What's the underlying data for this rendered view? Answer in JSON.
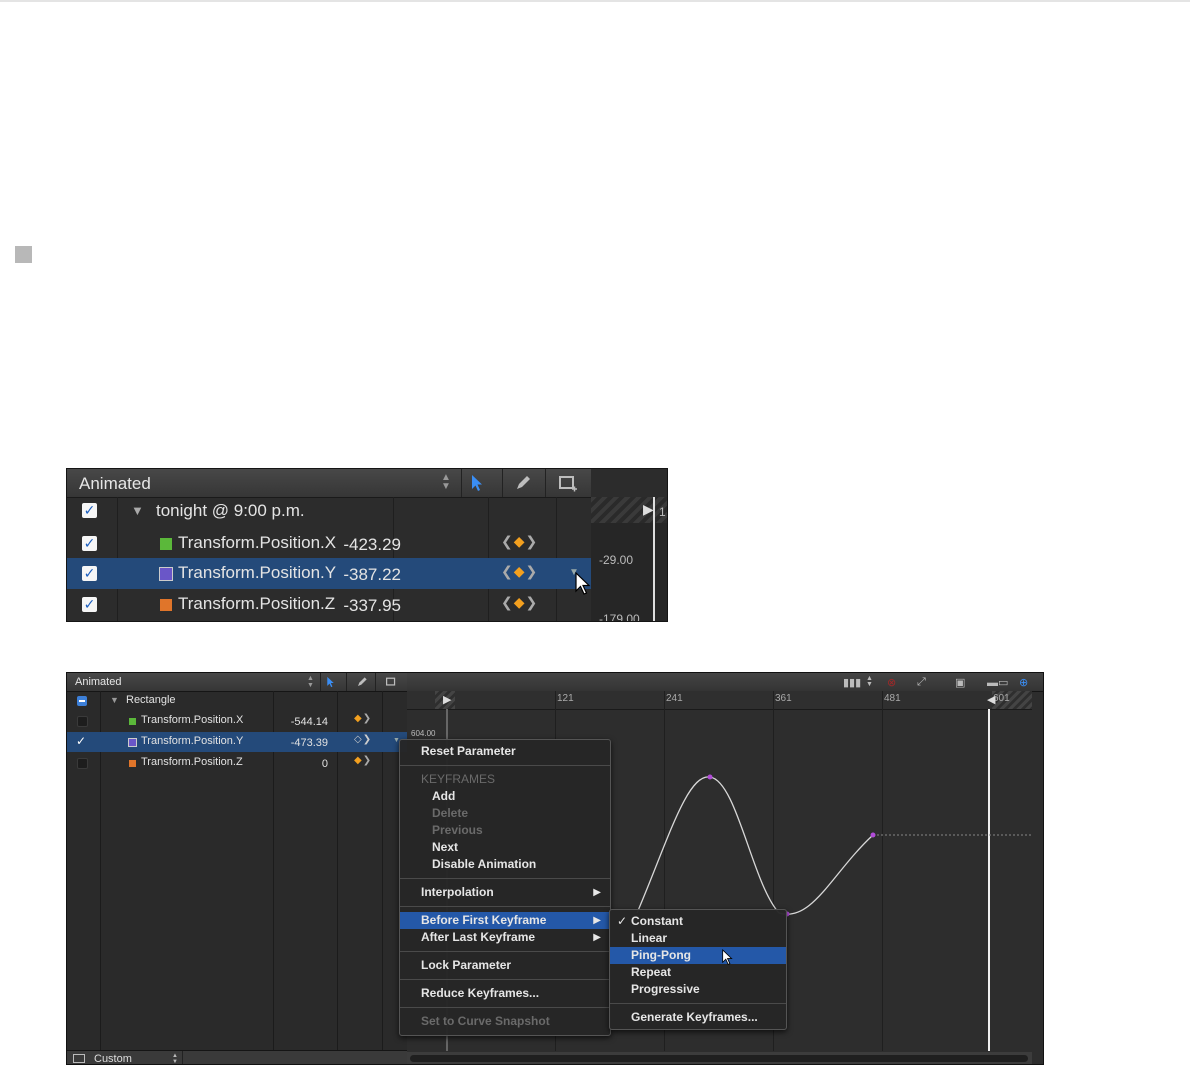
{
  "colors": {
    "selection": "#244a7a",
    "menu_highlight": "#2458a8",
    "keyframe": "#f3a01f",
    "swatch_x": "#5bb83a",
    "swatch_y": "#6a56c8",
    "swatch_z": "#e0752a",
    "curve": "#d8d8d8",
    "curve_point": "#b14cd8"
  },
  "panel_zoom": {
    "title": "Animated",
    "group": "tonight @ 9:00 p.m.",
    "rows": [
      {
        "name": "Transform.Position.X",
        "value": "-423.29",
        "swatch": "swatch_x"
      },
      {
        "name": "Transform.Position.Y",
        "value": "-387.22",
        "swatch": "swatch_y",
        "selected": true
      },
      {
        "name": "Transform.Position.Z",
        "value": "-337.95",
        "swatch": "swatch_z"
      }
    ],
    "ruler_value": "1",
    "graph_labels": [
      "-29.00",
      "-179.00"
    ],
    "icons": [
      "updown-icon",
      "arrow-tool-icon",
      "pen-tool-icon",
      "frame-tool-icon",
      "checkmark-icon",
      "disclosure-triangle-icon",
      "keyframe-nav-icon",
      "dropdown-arrow-icon",
      "cursor-icon"
    ]
  },
  "panel_main": {
    "title": "Animated",
    "group": "Rectangle",
    "rows": [
      {
        "name": "Transform.Position.X",
        "value": "-544.14",
        "swatch": "swatch_x"
      },
      {
        "name": "Transform.Position.Y",
        "value": "-473.39",
        "swatch": "swatch_y",
        "selected": true
      },
      {
        "name": "Transform.Position.Z",
        "value": "0",
        "swatch": "swatch_z"
      }
    ],
    "footer_label": "Custom",
    "ruler_ticks": [
      "121",
      "241",
      "361",
      "481",
      "601"
    ],
    "graph_label": "604.00",
    "icons": [
      "waveform-icon",
      "close-circle-icon",
      "curve-edit-icon",
      "camera-icon",
      "ruler-slider-icon",
      "zoom-icon"
    ]
  },
  "context_menu": {
    "reset": "Reset Parameter",
    "keyframes_header": "KEYFRAMES",
    "add": "Add",
    "delete": "Delete",
    "previous": "Previous",
    "next": "Next",
    "disable_animation": "Disable Animation",
    "interpolation": "Interpolation",
    "before_first": "Before First Keyframe",
    "after_last": "After Last Keyframe",
    "lock": "Lock Parameter",
    "reduce": "Reduce Keyframes...",
    "set_curve": "Set to Curve Snapshot"
  },
  "submenu": {
    "constant": "Constant",
    "linear": "Linear",
    "ping_pong": "Ping-Pong",
    "repeat": "Repeat",
    "progressive": "Progressive",
    "generate": "Generate Keyframes...",
    "checked": "Constant"
  }
}
